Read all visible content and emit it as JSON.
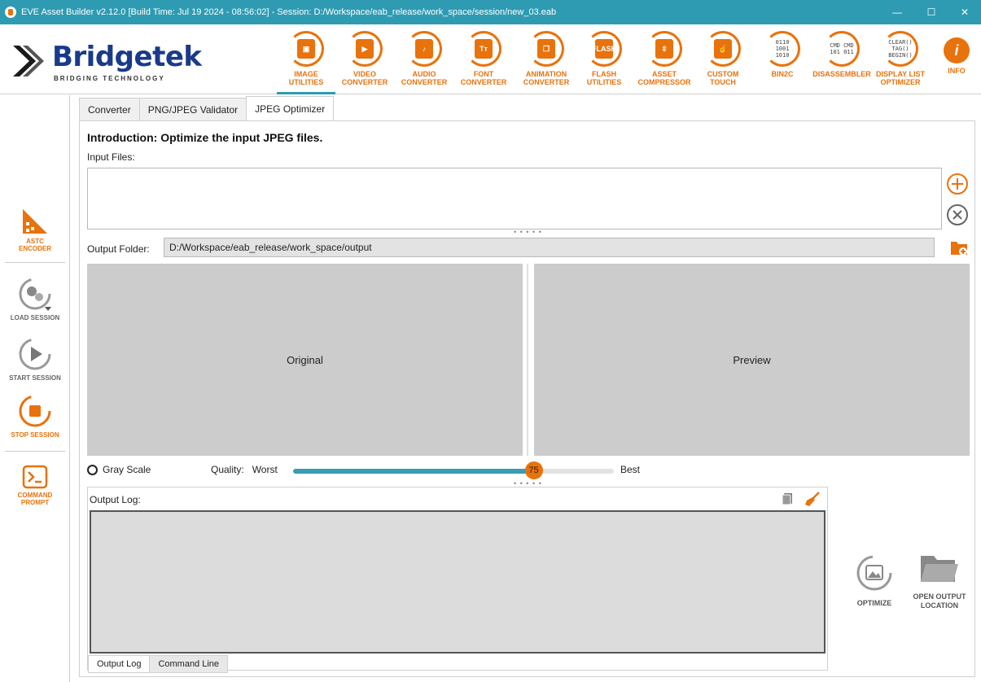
{
  "window": {
    "title": "EVE Asset Builder v2.12.0 [Build Time: Jul 19 2024 - 08:56:02] - Session: D:/Workspace/eab_release/work_space/session/new_03.eab",
    "minimize": "—",
    "maximize": "☐",
    "close": "✕"
  },
  "logo": {
    "brand": "Bridgetek",
    "tagline": "BRIDGING   TECHNOLOGY"
  },
  "toolbar": [
    {
      "id": "image-utilities",
      "label1": "IMAGE",
      "label2": "UTILITIES",
      "glyph": "▣",
      "active": true
    },
    {
      "id": "video-converter",
      "label1": "VIDEO",
      "label2": "CONVERTER",
      "glyph": "▶"
    },
    {
      "id": "audio-converter",
      "label1": "AUDIO",
      "label2": "CONVERTER",
      "glyph": "♪"
    },
    {
      "id": "font-converter",
      "label1": "FONT",
      "label2": "CONVERTER",
      "glyph": "Tт"
    },
    {
      "id": "animation-converter",
      "label1": "ANIMATION",
      "label2": "CONVERTER",
      "glyph": "❐"
    },
    {
      "id": "flash-utilities",
      "label1": "FLASH",
      "label2": "UTILITIES",
      "glyph": "FLASH"
    },
    {
      "id": "asset-compressor",
      "label1": "ASSET",
      "label2": "COMPRESSOR",
      "glyph": "⇳"
    },
    {
      "id": "custom-touch",
      "label1": "CUSTOM",
      "label2": "TOUCH",
      "glyph": "☝"
    },
    {
      "id": "bin2c",
      "label1": "BIN2C",
      "label2": "",
      "glyph": "0110 1001 1010"
    },
    {
      "id": "disassembler",
      "label1": "DISASSEMBLER",
      "label2": "",
      "glyph": "CMD CMD 101 011"
    },
    {
      "id": "display-list-optimizer",
      "label1": "DISPLAY LIST",
      "label2": "OPTIMIZER",
      "glyph": "CLEAR() TAG() BEGIN()"
    },
    {
      "id": "info",
      "label1": "INFO",
      "label2": "",
      "glyph": "i"
    }
  ],
  "sidebar": {
    "astc": {
      "label1": "ASTC",
      "label2": "ENCODER"
    },
    "load": {
      "label": "LOAD SESSION"
    },
    "start": {
      "label": "START SESSION"
    },
    "stop": {
      "label": "STOP SESSION"
    },
    "cmd": {
      "label1": "COMMAND",
      "label2": "PROMPT"
    }
  },
  "tabs": [
    "Converter",
    "PNG/JPEG Validator",
    "JPEG Optimizer"
  ],
  "main": {
    "intro": "Introduction: Optimize the input JPEG files.",
    "input_files_label": "Input Files:",
    "output_folder_label": "Output Folder:",
    "output_folder_value": "D:/Workspace/eab_release/work_space/output",
    "original_label": "Original",
    "preview_label": "Preview",
    "grayscale_label": "Gray Scale",
    "quality_label": "Quality:",
    "quality_min": "Worst",
    "quality_max": "Best",
    "quality_value": "75",
    "quality_fraction": 0.75,
    "splitter": "• • • • •"
  },
  "log": {
    "title": "Output Log:",
    "tabs": [
      "Output Log",
      "Command Line"
    ]
  },
  "actions": {
    "optimize": "OPTIMIZE",
    "open_output1": "OPEN OUTPUT",
    "open_output2": "LOCATION"
  },
  "colors": {
    "accent": "#e8720c",
    "titlebar": "#2e9bb2",
    "brand": "#1a3a8a"
  }
}
